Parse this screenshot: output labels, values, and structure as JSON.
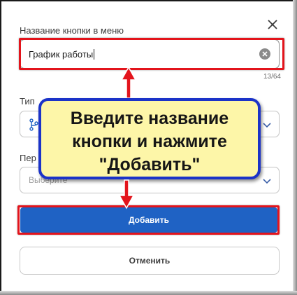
{
  "dialog": {
    "name_label": "Название кнопки в меню",
    "name_value": "График работы",
    "name_counter": "13/64",
    "type_label": "Тип",
    "per_label": "Пер",
    "per_placeholder": "Выберите",
    "add_button": "Добавить",
    "cancel_button": "Отменить"
  },
  "callout": {
    "text": "Введите название\nкнопки и нажмите\n\"Добавить\""
  },
  "icons": {
    "close": "close-icon",
    "clear": "clear-icon",
    "select_chevron": "chevron-down-icon",
    "type": "branch-icon",
    "arrow": "arrow-icon"
  },
  "colors": {
    "primary_button": "#1f62c4",
    "highlight_outline": "#e3141c",
    "callout_fill": "#fdf6a8",
    "callout_border": "#1b33c8"
  }
}
